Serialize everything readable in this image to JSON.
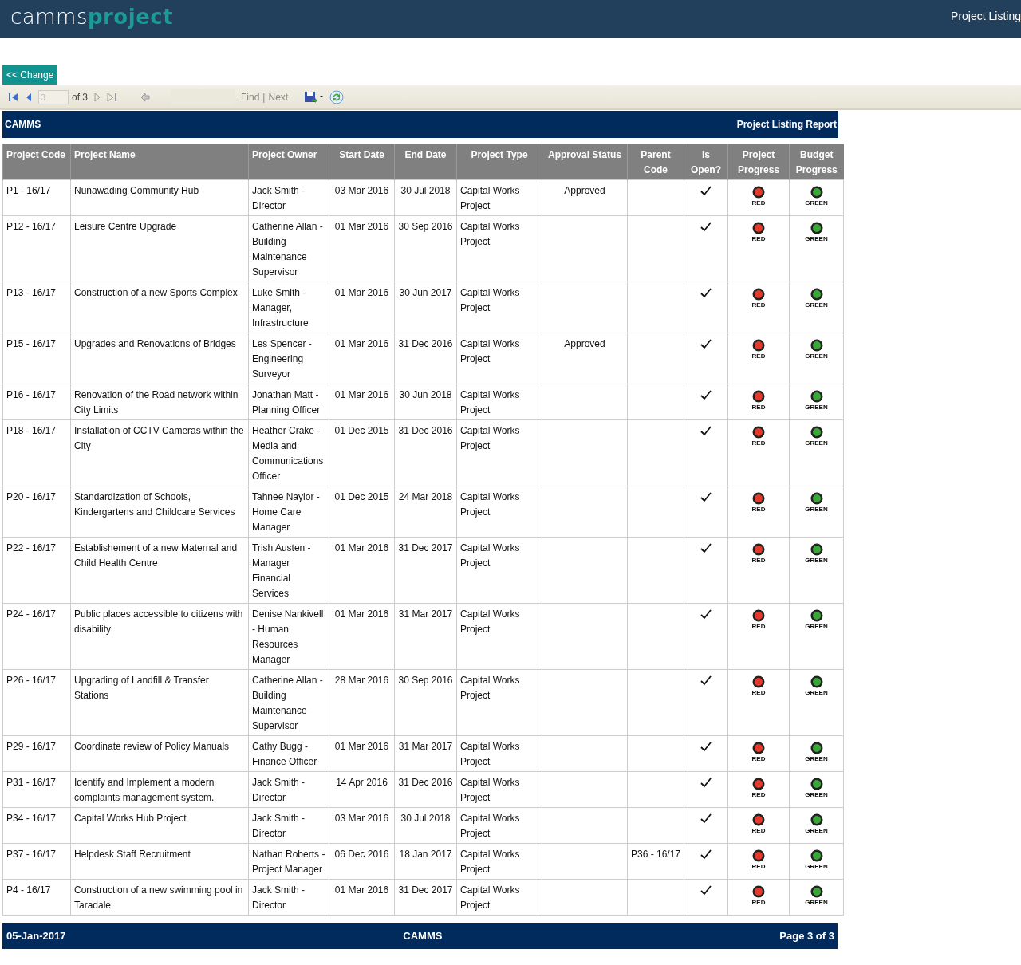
{
  "app": {
    "logo_left": "camms",
    "logo_right": "project",
    "page_title": "Project Listing"
  },
  "change_button": "<< Change",
  "toolbar": {
    "page_value": "3",
    "page_of": "of 3",
    "find": "Find",
    "separator": "|",
    "next": "Next"
  },
  "report_header": {
    "left": "CAMMS",
    "right": "Project Listing Report"
  },
  "columns": [
    "Project Code",
    "Project Name",
    "Project Owner",
    "Start Date",
    "End Date",
    "Project Type",
    "Approval Status",
    "Parent Code",
    "Is Open?",
    "Project Progress",
    "Budget Progress"
  ],
  "rows": [
    {
      "code": "P1 - 16/17",
      "name": "Nunawading Community Hub",
      "owner": "Jack Smith - Director",
      "start": "03 Mar 2016",
      "end": "30 Jul 2018",
      "type": "Capital Works Project",
      "approval": "Approved",
      "parent": "",
      "open": true,
      "project_progress": {
        "label": "RED",
        "color": "#e53a2a"
      },
      "budget_progress": {
        "label": "GREEN",
        "color": "#3aa63a"
      }
    },
    {
      "code": "P12 - 16/17",
      "name": "Leisure Centre Upgrade",
      "owner": "Catherine Allan - Building Maintenance Supervisor",
      "start": "01 Mar 2016",
      "end": "30 Sep 2016",
      "type": "Capital Works Project",
      "approval": "",
      "parent": "",
      "open": true,
      "project_progress": {
        "label": "RED",
        "color": "#e53a2a"
      },
      "budget_progress": {
        "label": "GREEN",
        "color": "#3aa63a"
      }
    },
    {
      "code": "P13 - 16/17",
      "name": "Construction of a new Sports Complex",
      "owner": "Luke Smith - Manager, Infrastructure",
      "start": "01 Mar 2016",
      "end": "30 Jun 2017",
      "type": "Capital Works Project",
      "approval": "",
      "parent": "",
      "open": true,
      "project_progress": {
        "label": "RED",
        "color": "#e53a2a"
      },
      "budget_progress": {
        "label": "GREEN",
        "color": "#3aa63a"
      }
    },
    {
      "code": "P15 - 16/17",
      "name": "Upgrades and Renovations of Bridges",
      "owner": "Les Spencer - Engineering Surveyor",
      "start": "01 Mar 2016",
      "end": "31 Dec 2016",
      "type": "Capital Works Project",
      "approval": "Approved",
      "parent": "",
      "open": true,
      "project_progress": {
        "label": "RED",
        "color": "#e53a2a"
      },
      "budget_progress": {
        "label": "GREEN",
        "color": "#3aa63a"
      }
    },
    {
      "code": "P16 - 16/17",
      "name": "Renovation of the Road network within City Limits",
      "owner": "Jonathan Matt - Planning Officer",
      "start": "01 Mar 2016",
      "end": "30 Jun 2018",
      "type": "Capital Works Project",
      "approval": "",
      "parent": "",
      "open": true,
      "project_progress": {
        "label": "RED",
        "color": "#e53a2a"
      },
      "budget_progress": {
        "label": "GREEN",
        "color": "#3aa63a"
      }
    },
    {
      "code": "P18 - 16/17",
      "name": "Installation of CCTV Cameras within the City",
      "owner": "Heather Crake - Media and Communications Officer",
      "start": "01 Dec 2015",
      "end": "31 Dec 2016",
      "type": "Capital Works Project",
      "approval": "",
      "parent": "",
      "open": true,
      "project_progress": {
        "label": "RED",
        "color": "#e53a2a"
      },
      "budget_progress": {
        "label": "GREEN",
        "color": "#3aa63a"
      }
    },
    {
      "code": "P20 - 16/17",
      "name": "Standardization of Schools, Kindergartens and Childcare Services",
      "owner": "Tahnee Naylor - Home Care Manager",
      "start": "01 Dec 2015",
      "end": "24 Mar 2018",
      "type": "Capital Works Project",
      "approval": "",
      "parent": "",
      "open": true,
      "project_progress": {
        "label": "RED",
        "color": "#e53a2a"
      },
      "budget_progress": {
        "label": "GREEN",
        "color": "#3aa63a"
      }
    },
    {
      "code": "P22 - 16/17",
      "name": "Establishement of a new Maternal and Child Health Centre",
      "owner": "Trish Austen - Manager Financial Services",
      "start": "01 Mar 2016",
      "end": "31 Dec 2017",
      "type": "Capital Works Project",
      "approval": "",
      "parent": "",
      "open": true,
      "project_progress": {
        "label": "RED",
        "color": "#e53a2a"
      },
      "budget_progress": {
        "label": "GREEN",
        "color": "#3aa63a"
      }
    },
    {
      "code": "P24 - 16/17",
      "name": "Public places accessible to citizens with disability",
      "owner": "Denise Nankivell - Human Resources Manager",
      "start": "01 Mar 2016",
      "end": "31 Mar 2017",
      "type": "Capital Works Project",
      "approval": "",
      "parent": "",
      "open": true,
      "project_progress": {
        "label": "RED",
        "color": "#e53a2a"
      },
      "budget_progress": {
        "label": "GREEN",
        "color": "#3aa63a"
      }
    },
    {
      "code": "P26 - 16/17",
      "name": "Upgrading of Landfill & Transfer Stations",
      "owner": "Catherine Allan - Building Maintenance Supervisor",
      "start": "28 Mar 2016",
      "end": "30 Sep 2016",
      "type": "Capital Works Project",
      "approval": "",
      "parent": "",
      "open": true,
      "project_progress": {
        "label": "RED",
        "color": "#e53a2a"
      },
      "budget_progress": {
        "label": "GREEN",
        "color": "#3aa63a"
      }
    },
    {
      "code": "P29 - 16/17",
      "name": "Coordinate review of Policy Manuals",
      "owner": "Cathy Bugg - Finance Officer",
      "start": "01 Mar 2016",
      "end": "31 Mar 2017",
      "type": "Capital Works Project",
      "approval": "",
      "parent": "",
      "open": true,
      "project_progress": {
        "label": "RED",
        "color": "#e53a2a"
      },
      "budget_progress": {
        "label": "GREEN",
        "color": "#3aa63a"
      }
    },
    {
      "code": "P31 - 16/17",
      "name": "Identify and Implement a modern complaints management system.",
      "owner": "Jack Smith - Director",
      "start": "14 Apr 2016",
      "end": "31 Dec 2016",
      "type": "Capital Works Project",
      "approval": "",
      "parent": "",
      "open": true,
      "project_progress": {
        "label": "RED",
        "color": "#e53a2a"
      },
      "budget_progress": {
        "label": "GREEN",
        "color": "#3aa63a"
      }
    },
    {
      "code": "P34 - 16/17",
      "name": "Capital Works Hub Project",
      "owner": "Jack Smith - Director",
      "start": "03 Mar 2016",
      "end": "30 Jul 2018",
      "type": "Capital Works Project",
      "approval": "",
      "parent": "",
      "open": true,
      "project_progress": {
        "label": "RED",
        "color": "#e53a2a"
      },
      "budget_progress": {
        "label": "GREEN",
        "color": "#3aa63a"
      }
    },
    {
      "code": "P37 - 16/17",
      "name": "Helpdesk Staff Recruitment",
      "owner": "Nathan Roberts - Project Manager",
      "start": "06 Dec 2016",
      "end": "18 Jan 2017",
      "type": "Capital Works Project",
      "approval": "",
      "parent": "P36 - 16/17",
      "open": true,
      "project_progress": {
        "label": "RED",
        "color": "#e53a2a"
      },
      "budget_progress": {
        "label": "GREEN",
        "color": "#3aa63a"
      }
    },
    {
      "code": "P4 - 16/17",
      "name": "Construction of a new swimming pool in Taradale",
      "owner": "Jack Smith - Director",
      "start": "01 Mar 2016",
      "end": "31 Dec 2017",
      "type": "Capital Works Project",
      "approval": "",
      "parent": "",
      "open": true,
      "project_progress": {
        "label": "RED",
        "color": "#e53a2a"
      },
      "budget_progress": {
        "label": "GREEN",
        "color": "#3aa63a"
      }
    }
  ],
  "report_footer": {
    "date": "05-Jan-2017",
    "center": "CAMMS",
    "page": "Page 3 of 3"
  }
}
